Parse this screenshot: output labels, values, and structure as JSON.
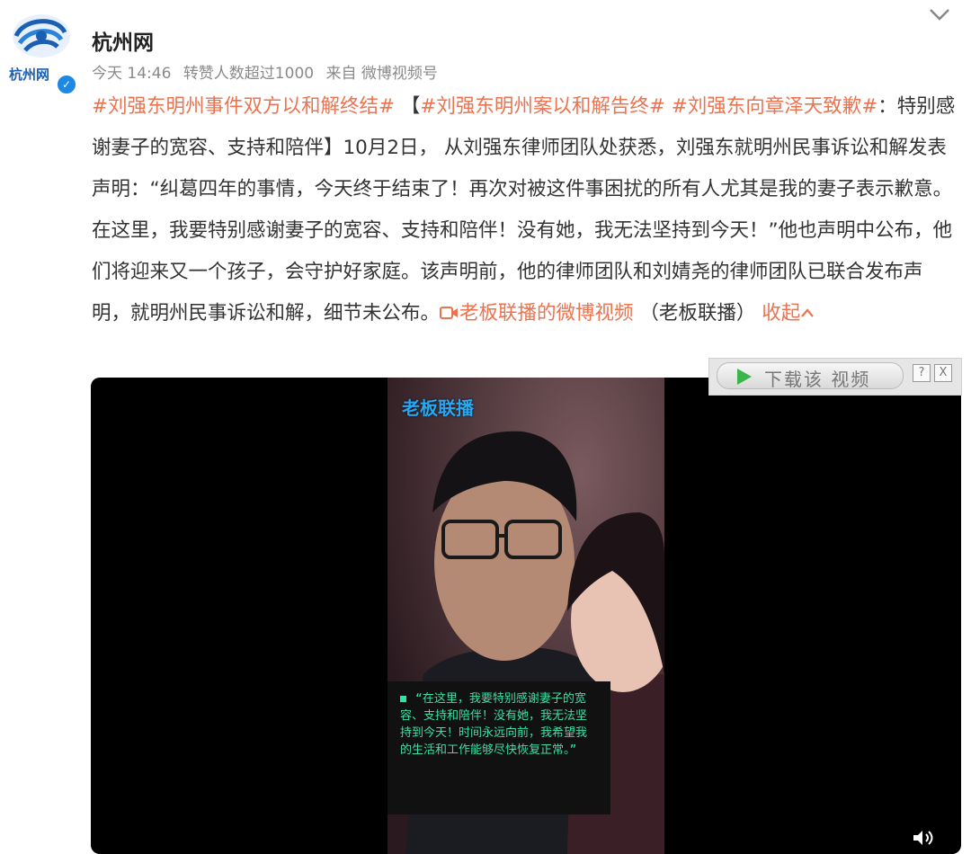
{
  "author": {
    "name": "杭州网",
    "logo_text": "杭州网",
    "verified": true
  },
  "meta": {
    "time": "今天 14:46",
    "reposts": "转赞人数超过1000",
    "source": "来自 微博视频号"
  },
  "post": {
    "hashtag1": "#刘强东明州事件双方以和解终结#",
    "bracket_open": " 【",
    "hashtag2": "#刘强东明州案以和解告终#",
    "hashtag3": "#刘强东向章泽天致歉#",
    "text1": "：特别感谢妻子的宽容、支持和陪伴】10月2日， 从刘强东律师团队处获悉，刘强东就明州民事诉讼和解发表声明：“纠葛四年的事情，今天终于结束了！再次对被这件事困扰的所有人尤其是我的妻子表示歉意。在这里，我要特别感谢妻子的宽容、支持和陪伴！没有她，我无法坚持到今天！”他也声明中公布，他们将迎来又一个孩子，会守护好家庭。该声明前，他的律师团队和刘婧尧的律师团队已联合发布声明，就明州民事诉讼和解，细节未公布。",
    "video_link": "老板联播的微博视频",
    "video_source": " （老板联播）",
    "collapse": "收起"
  },
  "video": {
    "watermark": "老板联播",
    "subtitle": "“在这里，我要特别感谢妻子的宽容、支持和陪伴！没有她，我无法坚持到今天！时间永远向前，我希望我的生活和工作能够尽快恢复正常。”"
  },
  "download": {
    "label": "下载该 视频",
    "help": "?",
    "close": "X"
  },
  "colors": {
    "accent": "#eb7350",
    "subtitle": "#38e0a8",
    "watermark": "#27a8f3"
  }
}
